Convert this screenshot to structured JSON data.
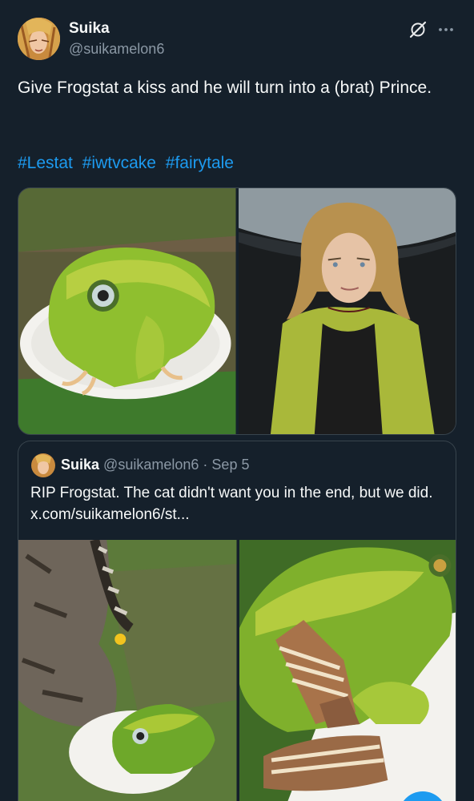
{
  "author": {
    "name": "Suika",
    "handle": "@suikamelon6"
  },
  "header_icons": [
    "grok-icon",
    "more-icon"
  ],
  "tweet": {
    "text": "Give Frogstat a kiss and he will turn into a (brat) Prince.",
    "hashtags": [
      "#Lestat",
      "#iwtvcake",
      "#fairytale"
    ]
  },
  "media": [
    {
      "alt": "frog-cake-on-plate"
    },
    {
      "alt": "long-haired-man-yellow-jacket"
    }
  ],
  "quote": {
    "name": "Suika",
    "handle": "@suikamelon6",
    "separator": "·",
    "date": "Sep 5",
    "text": "RIP Frogstat. The cat didn't want you in the end, but we did.",
    "link": "x.com/suikamelon6/st..."
  },
  "colors": {
    "background": "#15202b",
    "text": "#f7f9f9",
    "secondary": "#8b98a5",
    "accent": "#1d9bf0",
    "border": "#38444d"
  }
}
